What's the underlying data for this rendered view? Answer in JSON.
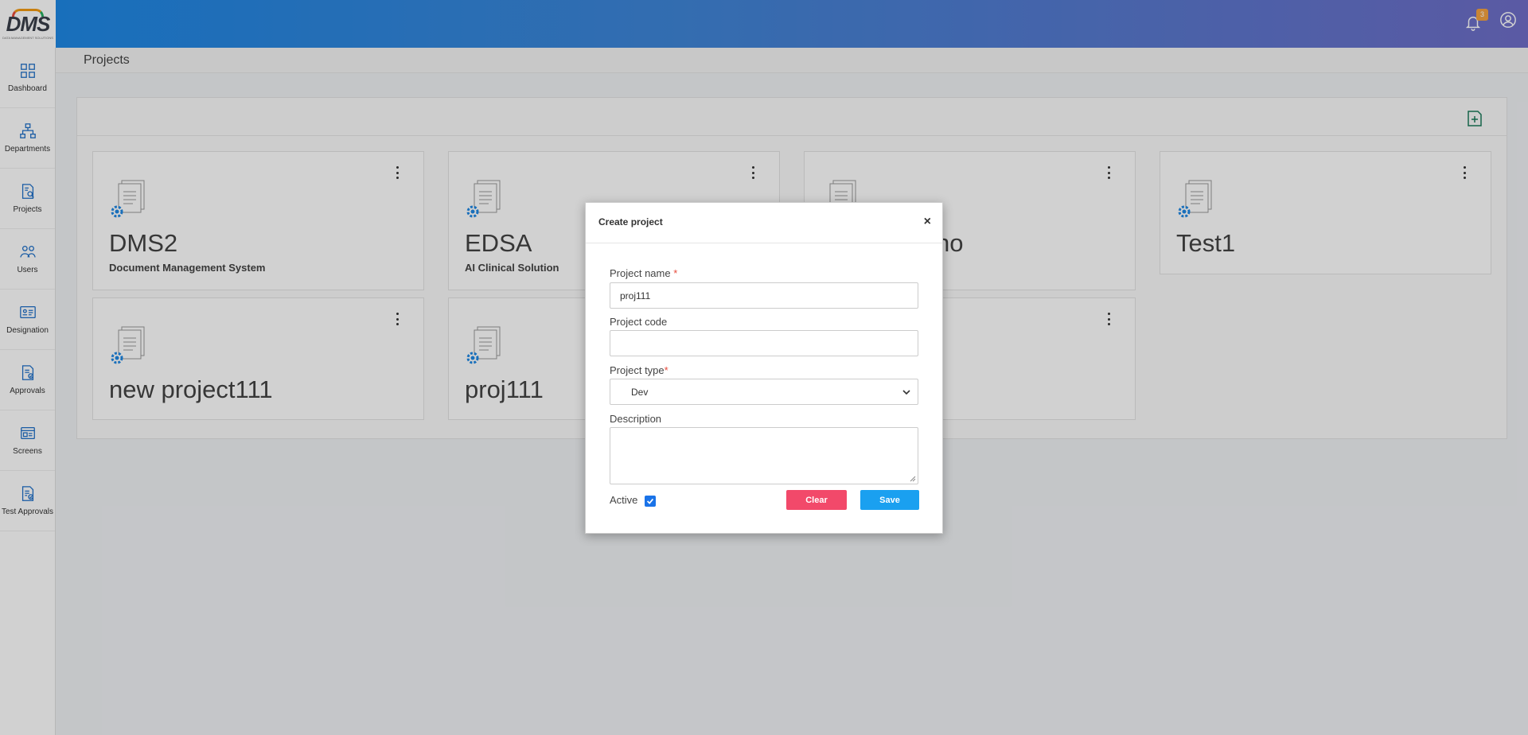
{
  "app": {
    "logo_text": "DMS",
    "logo_subtext": "DATA MANAGEMENT SOLUTIONS",
    "notification_count": "3"
  },
  "sidebar": {
    "items": [
      {
        "label": "Dashboard",
        "icon": "dashboard-icon"
      },
      {
        "label": "Departments",
        "icon": "departments-icon"
      },
      {
        "label": "Projects",
        "icon": "projects-icon"
      },
      {
        "label": "Users",
        "icon": "users-icon"
      },
      {
        "label": "Designation",
        "icon": "designation-icon"
      },
      {
        "label": "Approvals",
        "icon": "approvals-icon"
      },
      {
        "label": "Screens",
        "icon": "screens-icon"
      },
      {
        "label": "Test Approvals",
        "icon": "test-approvals-icon"
      }
    ]
  },
  "page": {
    "title": "Projects"
  },
  "projects": [
    {
      "name": "DMS2",
      "description": "Document Management System"
    },
    {
      "name": "EDSA",
      "description": "AI Clinical Solution"
    },
    {
      "name": "no",
      "description": ""
    },
    {
      "name": "Test1",
      "description": ""
    },
    {
      "name": "new project111",
      "description": ""
    },
    {
      "name": "proj111",
      "description": ""
    },
    {
      "name": "",
      "description": ""
    }
  ],
  "modal": {
    "title": "Create project",
    "close_symbol": "×",
    "project_name_label": "Project name",
    "project_name_value": "proj111",
    "project_code_label": "Project code",
    "project_code_value": "",
    "project_type_label": "Project type",
    "project_type_value": "Dev",
    "description_label": "Description",
    "description_value": "",
    "active_label": "Active",
    "active_checked": true,
    "clear_label": "Clear",
    "save_label": "Save",
    "required_mark": "*"
  },
  "colors": {
    "accent": "#1a73e8",
    "clear_button": "#f2496a",
    "save_button": "#1aa0f0",
    "badge": "#f4a340",
    "project_icon_gear": "#1e88e5"
  }
}
